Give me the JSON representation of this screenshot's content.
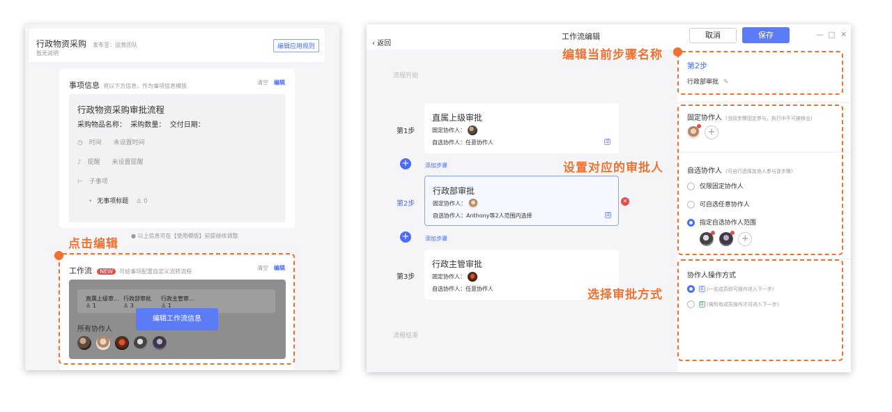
{
  "left": {
    "app_title": "行政物资采购",
    "publish_to": "发布至：运营团队",
    "no_desc": "暂无说明",
    "edit_rules_button": "编辑应用规则",
    "item_info": {
      "title": "事项信息",
      "hint": "将以下方信息，作为事项信息模版",
      "clear": "清空",
      "edit": "编辑",
      "process_title": "行政物资采购审批流程",
      "fields": "采购物品名称：  采购数量：  交付日期：",
      "time_label": "时间",
      "time_value": "未设置时间",
      "remind_label": "提醒",
      "remind_value": "未设置提醒",
      "subitem_label": "子事项",
      "subitem_title": "无事项标题",
      "subitem_count": "0",
      "footer_note": "以上信息可在【使用模版】前提继续调整"
    },
    "workflow": {
      "title": "工作流",
      "badge": "NEW",
      "hint": "可给事项配置自定义流转流程",
      "clear": "清空",
      "edit": "编辑",
      "steps": [
        {
          "name": "直属上级审...",
          "count": "1"
        },
        {
          "name": "行政部审批",
          "count": "3"
        },
        {
          "name": "行政主管审...",
          "count": "1"
        }
      ],
      "edit_workflow_button": "编辑工作流信息",
      "all_collaborators": "所有协作人"
    },
    "callout_click_edit": "点击编辑"
  },
  "right": {
    "back": "返回",
    "title": "工作流编辑",
    "cancel_button": "取消",
    "save_button": "保存",
    "flow_start": "流程开始",
    "flow_end": "流程结束",
    "add_step": "添加步骤",
    "steps": [
      {
        "label": "第1步",
        "name": "直属上级审批",
        "fixed": "固定协作人：",
        "optional": "自选协作人：任意协作人",
        "tag": "或"
      },
      {
        "label": "第2步",
        "name": "行政部审批",
        "fixed": "固定协作人：",
        "optional": "自选协作人：Anthony等2人范围内选择",
        "tag": "或"
      },
      {
        "label": "第3步",
        "name": "行政主管审批",
        "fixed": "固定协作人：",
        "optional": "自选协作人：任意协作人",
        "tag": ""
      }
    ],
    "side": {
      "step_label": "第2步",
      "step_name": "行政部审批",
      "fixed_title": "固定协作人",
      "fixed_hint": "(当前步骤固定参与，执行中不可被移出)",
      "optional_title": "自选协作人",
      "optional_hint": "(可自行选择其他人参与该步骤)",
      "opt1": "仅限固定协作人",
      "opt2": "可自选任意协作人",
      "opt3": "指定自选协作人范围",
      "mode_title": "协作人操作方式",
      "mode1_tag": "或",
      "mode1": "(一名成员即可操作进入下一步)",
      "mode2_tag": "且",
      "mode2": "(需所有成员操作才可进入下一步)"
    },
    "callout_step_name": "编辑当前步骤名称",
    "callout_approver": "设置对应的审批人",
    "callout_method": "选择审批方式"
  },
  "colors": {
    "accent": "#4a6cf7",
    "annotation": "#f07030",
    "danger": "#e84a4a"
  }
}
